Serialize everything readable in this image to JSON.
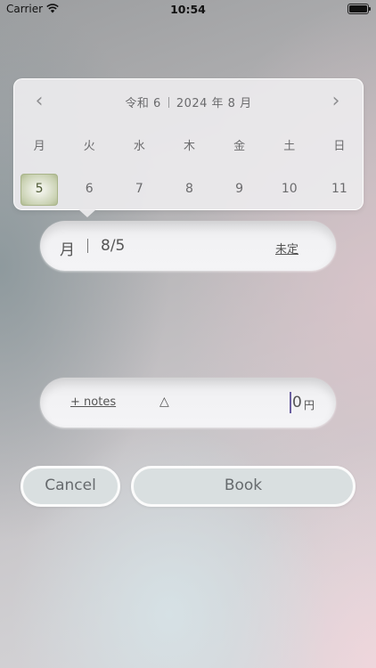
{
  "status_bar": {
    "carrier": "Carrier",
    "time": "10:54"
  },
  "calendar": {
    "era": "令和 6",
    "month_label": "2024 年 8 月",
    "weekdays": [
      "月",
      "火",
      "水",
      "木",
      "金",
      "土",
      "日"
    ],
    "days": [
      "5",
      "6",
      "7",
      "8",
      "9",
      "10",
      "11"
    ],
    "selected_day": "5",
    "selected_color": "#a9b48a"
  },
  "date_field": {
    "weekday": "月",
    "date": "8/5",
    "undecided_label": "未定"
  },
  "notes_field": {
    "notes_link": "+ notes",
    "triangle": "△",
    "amount": "0",
    "currency": "円",
    "caret_color": "#6a5fa0"
  },
  "buttons": {
    "cancel": "Cancel",
    "book": "Book"
  }
}
